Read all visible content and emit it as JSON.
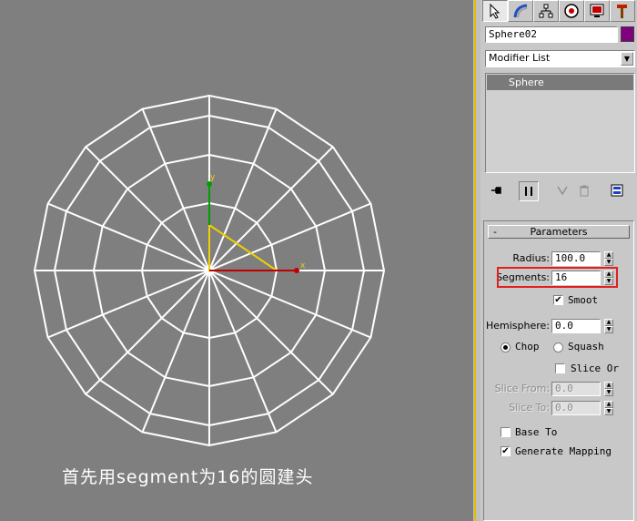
{
  "caption": "首先用segment为16的圆建头",
  "viewport": {
    "axis_x_label": "x",
    "axis_y_label": "y",
    "wire_color": "#ffffff",
    "gizmo_color": "#f0d000",
    "x_axis_color": "#c00000",
    "y_axis_color": "#00a000"
  },
  "panel": {
    "tabs": [
      "create-tab",
      "modify-tab",
      "hierarchy-tab",
      "motion-tab",
      "display-tab",
      "utilities-tab"
    ],
    "object_name": "Sphere02",
    "object_color": "#800080",
    "modifier_list_label": "Modifier List",
    "stack_item": "Sphere",
    "parameters": {
      "header_minus": "-",
      "header_title": "Parameters",
      "radius_label": "Radius:",
      "radius_value": "100.0",
      "segments_label": "Segments:",
      "segments_value": "16",
      "smooth_label": "Smoot",
      "smooth_checked": "✔",
      "hemisphere_label": "Hemisphere:",
      "hemisphere_value": "0.0",
      "chop_label": "Chop",
      "squash_label": "Squash",
      "slice_on_label": "Slice Or",
      "slice_from_label": "Slice From:",
      "slice_from_value": "0.0",
      "slice_to_label": "Slice To:",
      "slice_to_value": "0.0",
      "base_to_label": "Base To",
      "generate_mapping_label": "Generate Mapping",
      "generate_mapping_checked": "✔"
    },
    "highlight_color": "#e02020"
  }
}
